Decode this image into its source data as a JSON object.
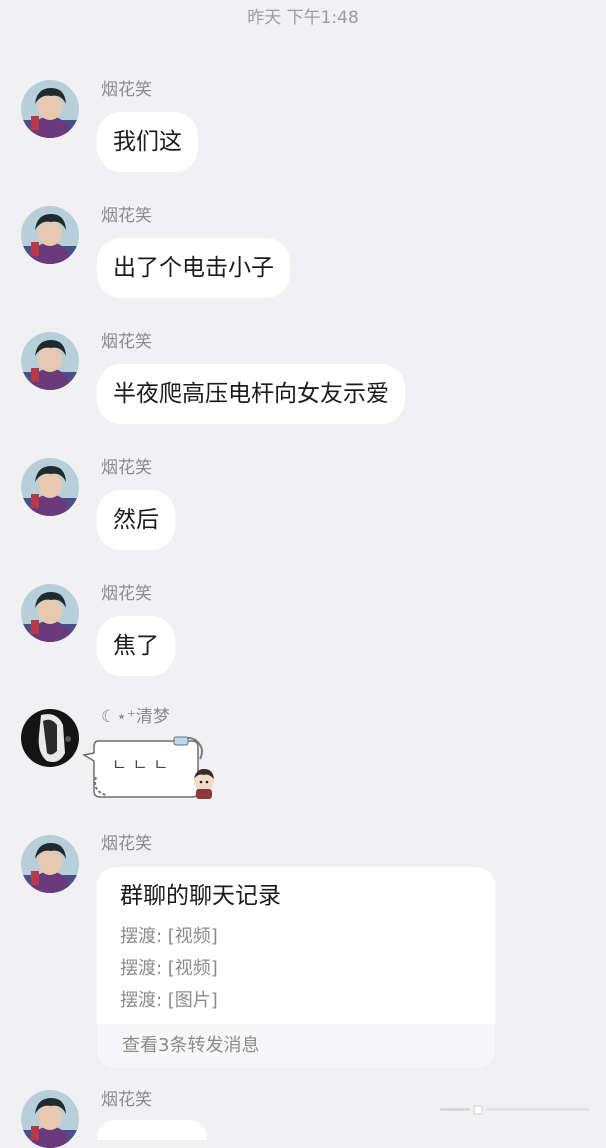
{
  "timestamp": "昨天 下午1:48",
  "messages": [
    {
      "sender": "烟花笑",
      "text": "我们这"
    },
    {
      "sender": "烟花笑",
      "text": "出了个电击小子"
    },
    {
      "sender": "烟花笑",
      "text": "半夜爬高压电杆向女友示爱"
    },
    {
      "sender": "烟花笑",
      "text": "然后"
    },
    {
      "sender": "烟花笑",
      "text": "焦了"
    },
    {
      "sender": "☾⋆⁺清梦",
      "sticker": "ㄴㄴㄴ"
    },
    {
      "sender": "烟花笑",
      "forward_card": {
        "title": "群聊的聊天记录",
        "lines": [
          "摆渡: [视频]",
          "摆渡: [视频]",
          "摆渡: [图片]"
        ],
        "footer": "查看3条转发消息"
      }
    },
    {
      "sender": "烟花笑"
    }
  ]
}
